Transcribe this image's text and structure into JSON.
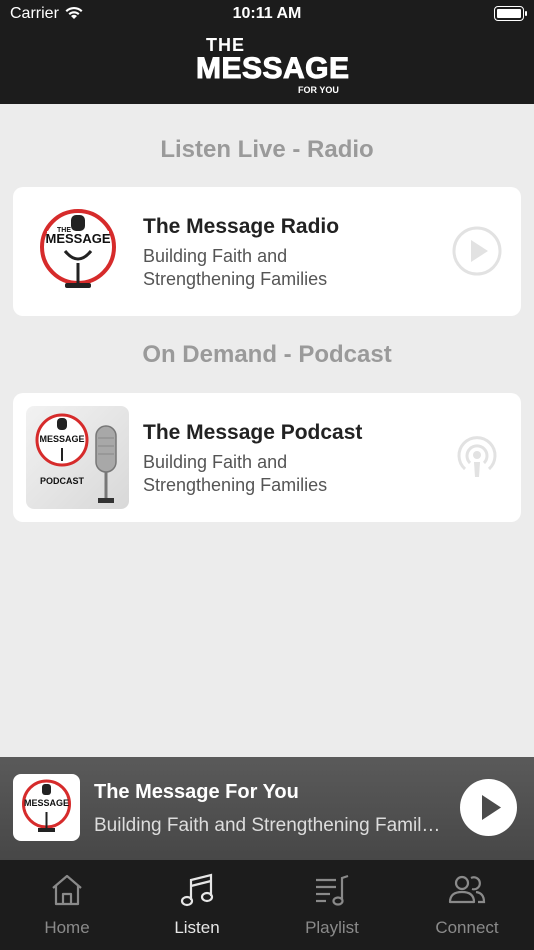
{
  "status_bar": {
    "carrier": "Carrier",
    "time": "10:11 AM"
  },
  "header": {
    "logo_line1": "THE",
    "logo_line2": "MESSAGE",
    "logo_line3": "FOR YOU"
  },
  "sections": {
    "live_title": "Listen Live - Radio",
    "podcast_title": "On Demand - Podcast"
  },
  "radio_card": {
    "title": "The Message Radio",
    "subtitle_line1": "Building Faith and",
    "subtitle_line2": "Strengthening Families",
    "action_icon": "play-circle-icon"
  },
  "podcast_card": {
    "title": "The Message Podcast",
    "subtitle_line1": "Building Faith and",
    "subtitle_line2": "Strengthening Families",
    "thumb_text": "PODCAST",
    "action_icon": "podcast-icon"
  },
  "mini_player": {
    "title": "The Message For You",
    "subtitle": "Building Faith and Strengthening Families"
  },
  "tabs": [
    {
      "label": "Home",
      "icon": "home-icon",
      "active": false
    },
    {
      "label": "Listen",
      "icon": "music-note-icon",
      "active": true
    },
    {
      "label": "Playlist",
      "icon": "playlist-icon",
      "active": false
    },
    {
      "label": "Connect",
      "icon": "people-icon",
      "active": false
    }
  ],
  "colors": {
    "header_bg": "#1c1c1c",
    "brand_red": "#d62b2b",
    "page_bg": "#ececec"
  }
}
